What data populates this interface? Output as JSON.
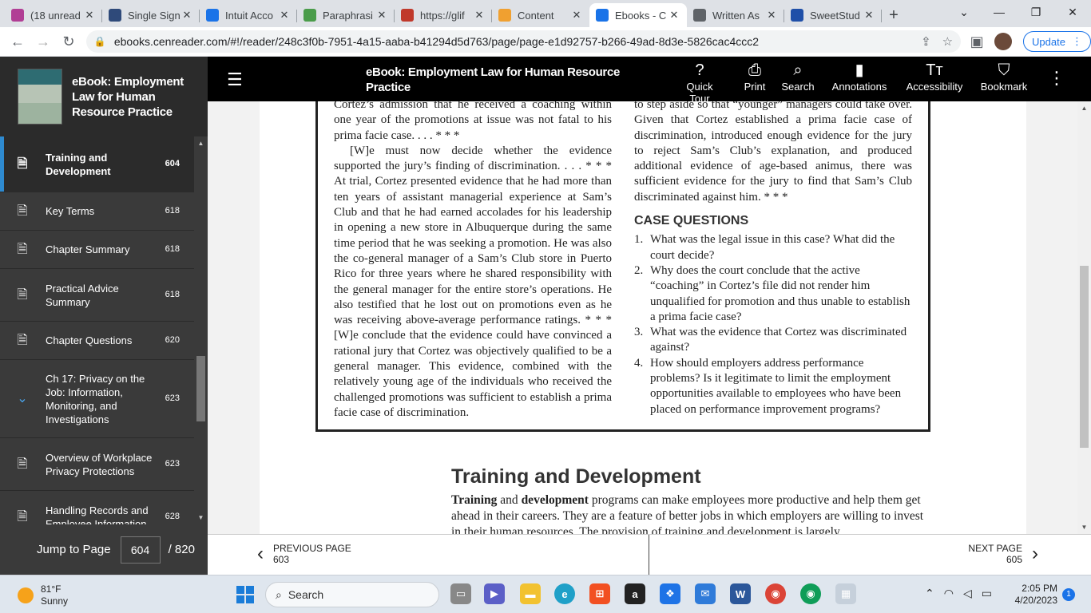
{
  "browser": {
    "tabs": [
      {
        "label": "(18 unread",
        "icon": "mail-icon",
        "color": "#b13e95"
      },
      {
        "label": "Single Sign",
        "icon": "sba-icon",
        "color": "#2f4a7a"
      },
      {
        "label": "Intuit Acco",
        "icon": "intuit-icon",
        "color": "#1a73e8"
      },
      {
        "label": "Paraphrasi",
        "icon": "quill-icon",
        "color": "#4a9c4a"
      },
      {
        "label": "https://glif",
        "icon": "glif-icon",
        "color": "#c0392b"
      },
      {
        "label": "Content",
        "icon": "pencil-icon",
        "color": "#f0a030"
      },
      {
        "label": "Ebooks - C",
        "icon": "book-icon",
        "color": "#1a73e8"
      },
      {
        "label": "Written As",
        "icon": "globe-icon",
        "color": "#5f6368"
      },
      {
        "label": "SweetStud",
        "icon": "sweetstudy-icon",
        "color": "#1f4fa8"
      }
    ],
    "url": "ebooks.cenreader.com/#!/reader/248c3f0b-7951-4a15-aaba-b41294d5d763/page/page-e1d92757-b266-49ad-8d3e-5826cac4ccc2",
    "update_label": "Update"
  },
  "sidebar": {
    "book_title": "eBook: Employment Law for Human Resource Practice",
    "toc": [
      {
        "label": "Training and Development",
        "page": "604",
        "active": true
      },
      {
        "label": "Key Terms",
        "page": "618"
      },
      {
        "label": "Chapter Summary",
        "page": "618"
      },
      {
        "label": "Practical Advice Summary",
        "page": "618"
      },
      {
        "label": "Chapter Questions",
        "page": "620"
      },
      {
        "label": "Ch 17: Privacy on the Job: Information, Monitoring, and Investigations",
        "page": "623",
        "chapter": true
      },
      {
        "label": "Overview of Workplace Privacy Protections",
        "page": "623"
      },
      {
        "label": "Handling Records and Employee Information",
        "page": "628"
      }
    ],
    "jump_label": "Jump to Page",
    "jump_value": "604",
    "total_pages": "/ 820"
  },
  "reader": {
    "title": "eBook: Employment Law for Human Resource Practice",
    "tools": [
      {
        "label": "Quick Tour",
        "icon": "help-icon"
      },
      {
        "label": "Print",
        "icon": "print-icon"
      },
      {
        "label": "Search",
        "icon": "search-icon"
      },
      {
        "label": "Annotations",
        "icon": "annotations-icon"
      },
      {
        "label": "Accessibility",
        "icon": "accessibility-icon"
      },
      {
        "label": "Bookmark",
        "icon": "bookmark-icon"
      }
    ]
  },
  "content": {
    "left_col": [
      "Cortez’s admission that he received a coaching within one year of the promotions at issue was not fatal to his prima facie case. . . . * * *",
      "[W]e must now decide whether the evidence supported the jury’s finding of discrimination. . . . * * * At trial, Cortez presented evidence that he had more than ten years of assistant managerial experience at Sam’s Club and that he had earned accolades for his leadership in opening a new store in Albuquerque during the same time period that he was seeking a promotion. He was also the co-general manager of a Sam’s Club store in Puerto Rico for three years where he shared responsibility with the general manager for the entire store’s operations. He also testified that he lost out on promotions even as he was receiving above-average performance ratings. * * * [W]e conclude that the evidence could have convinced a rational jury that Cortez was objectively qualified to be a general manager. This evidence, combined with the relatively young age of the individuals who received the challenged promotions was sufficient to establish a prima facie case of discrimination."
    ],
    "right_col_text": "to step aside so that “younger” managers could take over. Given that Cortez established a prima facie case of discrimination, introduced enough evidence for the jury to reject Sam’s Club’s explanation, and produced additional evidence of age-based animus, there was sufficient evidence for the jury to find that Sam’s Club discriminated against him. * * *",
    "case_questions_heading": "CASE QUESTIONS",
    "questions": [
      {
        "n": "1.",
        "text": "What was the legal issue in this case? What did the court decide?"
      },
      {
        "n": "2.",
        "text": "Why does the court conclude that the active “coaching” in Cortez’s file did not render him unqualified for promotion and thus unable to establish a prima facie case?"
      },
      {
        "n": "3.",
        "text": "What was the evidence that Cortez was discriminated against?"
      },
      {
        "n": "4.",
        "text": "How should employers address performance problems? Is it legitimate to limit the employment opportunities available to employees who have been placed on performance improvement programs?"
      }
    ],
    "section_heading": "Training and Development",
    "section_bold_1": "Training",
    "section_and": " and ",
    "section_bold_2": "development",
    "section_rest": " programs can make employees more productive and help them get ahead in their careers. They are a feature of better jobs in which employers are willing to invest in their human resources. The provision of training and development is largely"
  },
  "pager": {
    "prev_label": "PREVIOUS PAGE",
    "prev_page": "603",
    "next_label": "NEXT PAGE",
    "next_page": "605"
  },
  "taskbar": {
    "temp": "81°F",
    "condition": "Sunny",
    "search_placeholder": "Search",
    "time": "2:05 PM",
    "date": "4/20/2023",
    "notifications": "1"
  }
}
